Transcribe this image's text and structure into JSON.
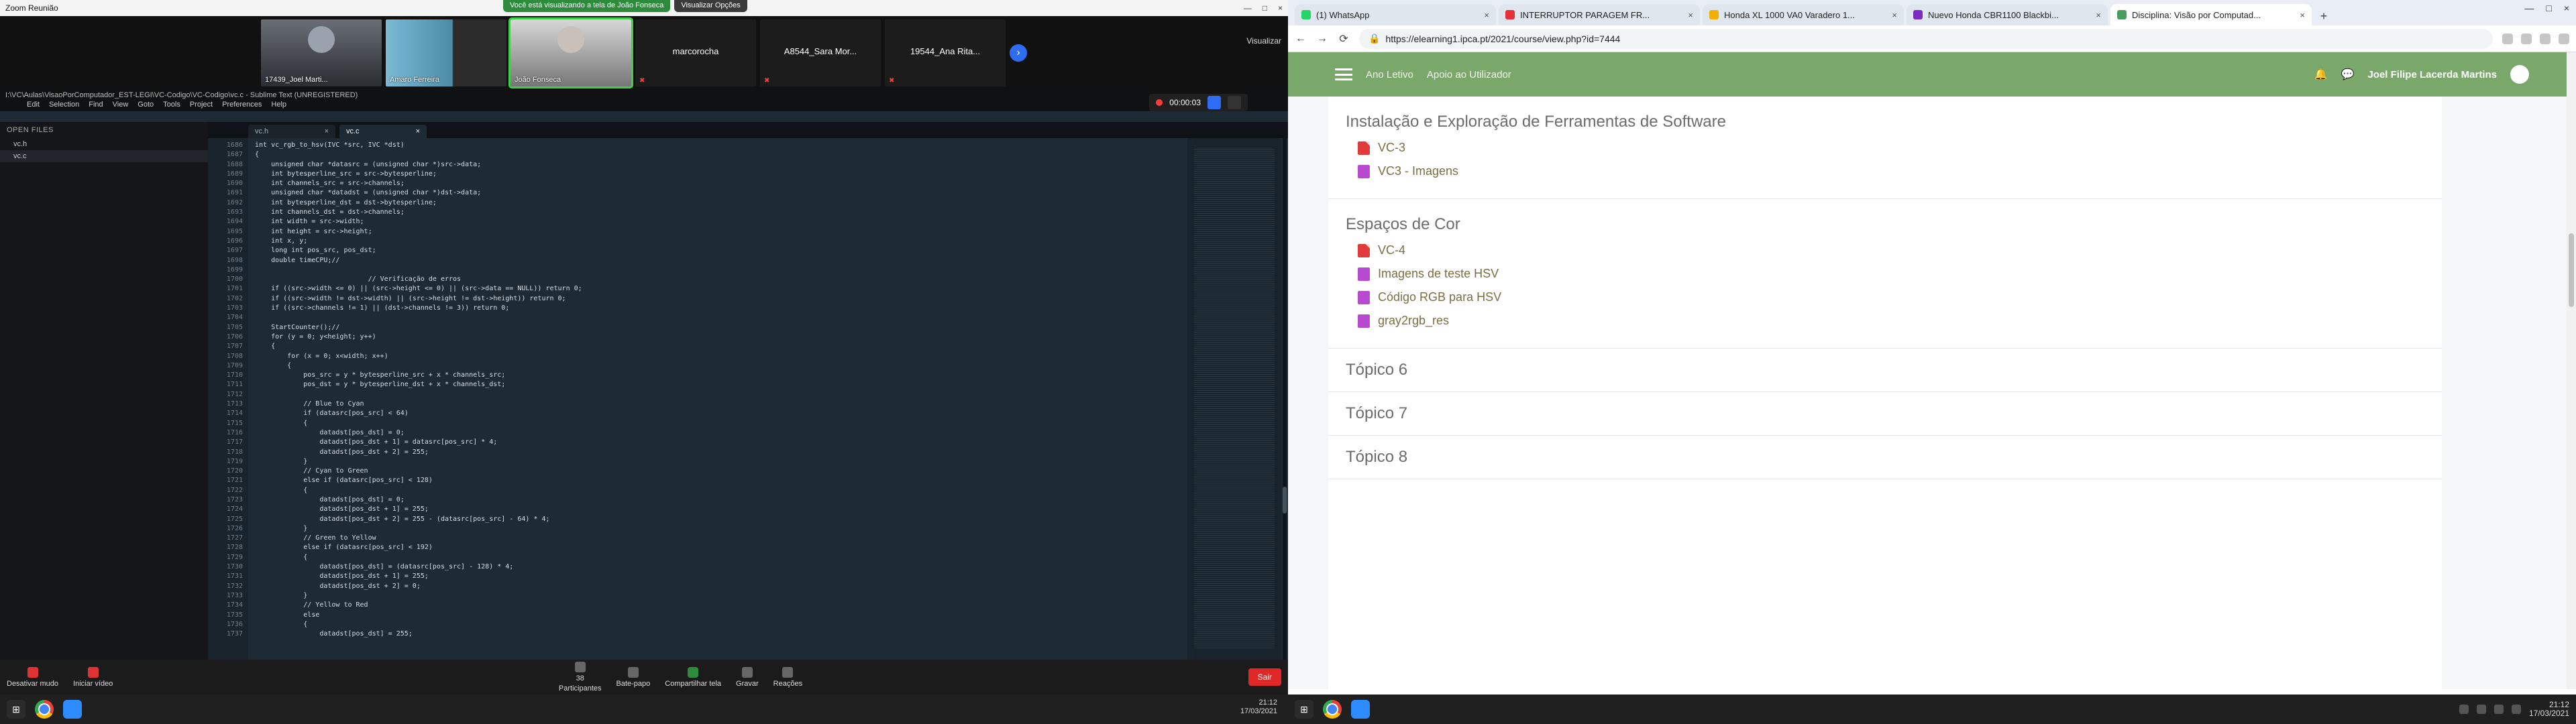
{
  "left": {
    "zoom_window_title": "Zoom Reunião",
    "share_status": "Você está visualizando a tela de João Fonseca",
    "view_options": "Visualizar Opções",
    "participants_tiles": [
      {
        "label": "17439_Joel Marti..."
      },
      {
        "label": "Amaro Ferreira"
      },
      {
        "label": "João Fonseca"
      },
      {
        "label": "marcorocha"
      },
      {
        "label": "A8544_Sara Mor..."
      },
      {
        "label": "19544_Ana Rita..."
      }
    ],
    "gallery_right_label": "Visualizar",
    "sublime_title": "I:\\VC\\Aulas\\VisaoPorComputador_EST-LEGI\\VC-Codigo\\VC-Codigo\\vc.c - Sublime Text (UNREGISTERED)",
    "sublime_menu": [
      "Edit",
      "Selection",
      "Find",
      "View",
      "Goto",
      "Tools",
      "Project",
      "Preferences",
      "Help"
    ],
    "timer": "00:00:03",
    "open_files_header": "OPEN FILES",
    "open_files": [
      "vc.h",
      "vc.c"
    ],
    "tabs": [
      {
        "label": "vc.h"
      },
      {
        "label": "vc.c"
      }
    ],
    "gutter_start": 1686,
    "code_lines": [
      "int vc_rgb_to_hsv(IVC *src, IVC *dst)",
      "{",
      "    unsigned char *datasrc = (unsigned char *)src->data;",
      "    int bytesperline_src = src->bytesperline;",
      "    int channels_src = src->channels;",
      "    unsigned char *datadst = (unsigned char *)dst->data;",
      "    int bytesperline_dst = dst->bytesperline;",
      "    int channels_dst = dst->channels;",
      "    int width = src->width;",
      "    int height = src->height;",
      "    int x, y;",
      "    long int pos_src, pos_dst;",
      "    double timeCPU;//",
      "",
      "                            // Verificação de erros",
      "    if ((src->width <= 0) || (src->height <= 0) || (src->data == NULL)) return 0;",
      "    if ((src->width != dst->width) || (src->height != dst->height)) return 0;",
      "    if ((src->channels != 1) || (dst->channels != 3)) return 0;",
      "",
      "    StartCounter();//",
      "    for (y = 0; y<height; y++)",
      "    {",
      "        for (x = 0; x<width; x++)",
      "        {",
      "            pos_src = y * bytesperline_src + x * channels_src;",
      "            pos_dst = y * bytesperline_dst + x * channels_dst;",
      "",
      "            // Blue to Cyan",
      "            if (datasrc[pos_src] < 64)",
      "            {",
      "                datadst[pos_dst] = 0;",
      "                datadst[pos_dst + 1] = datasrc[pos_src] * 4;",
      "                datadst[pos_dst + 2] = 255;",
      "            }",
      "            // Cyan to Green",
      "            else if (datasrc[pos_src] < 128)",
      "            {",
      "                datadst[pos_dst] = 0;",
      "                datadst[pos_dst + 1] = 255;",
      "                datadst[pos_dst + 2] = 255 - (datasrc[pos_src] - 64) * 4;",
      "            }",
      "            // Green to Yellow",
      "            else if (datasrc[pos_src] < 192)",
      "            {",
      "                datadst[pos_dst] = (datasrc[pos_src] - 128) * 4;",
      "                datadst[pos_dst + 1] = 255;",
      "                datadst[pos_dst + 2] = 0;",
      "            }",
      "            // Yellow to Red",
      "            else",
      "            {",
      "                datadst[pos_dst] = 255;"
    ],
    "zoom_controls": {
      "left": [
        {
          "label": "Desativar mudo"
        },
        {
          "label": "Iniciar vídeo"
        }
      ],
      "center": [
        {
          "label": "Participantes",
          "count": "38"
        },
        {
          "label": "Bate-papo"
        },
        {
          "label": "Compartilhar tela"
        },
        {
          "label": "Gravar"
        },
        {
          "label": "Reações"
        }
      ],
      "end": "Sair"
    },
    "clock": {
      "time": "21:12",
      "date": "17/03/2021"
    }
  },
  "right": {
    "tabs": [
      {
        "label": "(1) WhatsApp"
      },
      {
        "label": "INTERRUPTOR PARAGEM FR..."
      },
      {
        "label": "Honda XL 1000 VA0 Varadero 1..."
      },
      {
        "label": "Nuevo Honda CBR1100 Blackbi..."
      },
      {
        "label": "Disciplina: Visão por Computad..."
      }
    ],
    "url": "https://elearning1.ipca.pt/2021/course/view.php?id=7444",
    "moodle_nav": {
      "menu1": "Ano Letivo",
      "menu2": "Apoio ao Utilizador",
      "user": "Joel Filipe Lacerda Martins"
    },
    "sections": [
      {
        "title": "Instalação e Exploração de Ferramentas de Software",
        "items": [
          {
            "type": "pdf",
            "label": "VC-3"
          },
          {
            "type": "archive",
            "label": "VC3 - Imagens"
          }
        ]
      },
      {
        "title": "Espaços de Cor",
        "items": [
          {
            "type": "pdf",
            "label": "VC-4"
          },
          {
            "type": "archive",
            "label": "Imagens de teste HSV"
          },
          {
            "type": "archive",
            "label": "Código RGB para HSV"
          },
          {
            "type": "archive",
            "label": "gray2rgb_res"
          }
        ]
      }
    ],
    "topics": [
      "Tópico 6",
      "Tópico 7",
      "Tópico 8"
    ],
    "clock": {
      "time": "21:12",
      "date": "17/03/2021"
    }
  }
}
